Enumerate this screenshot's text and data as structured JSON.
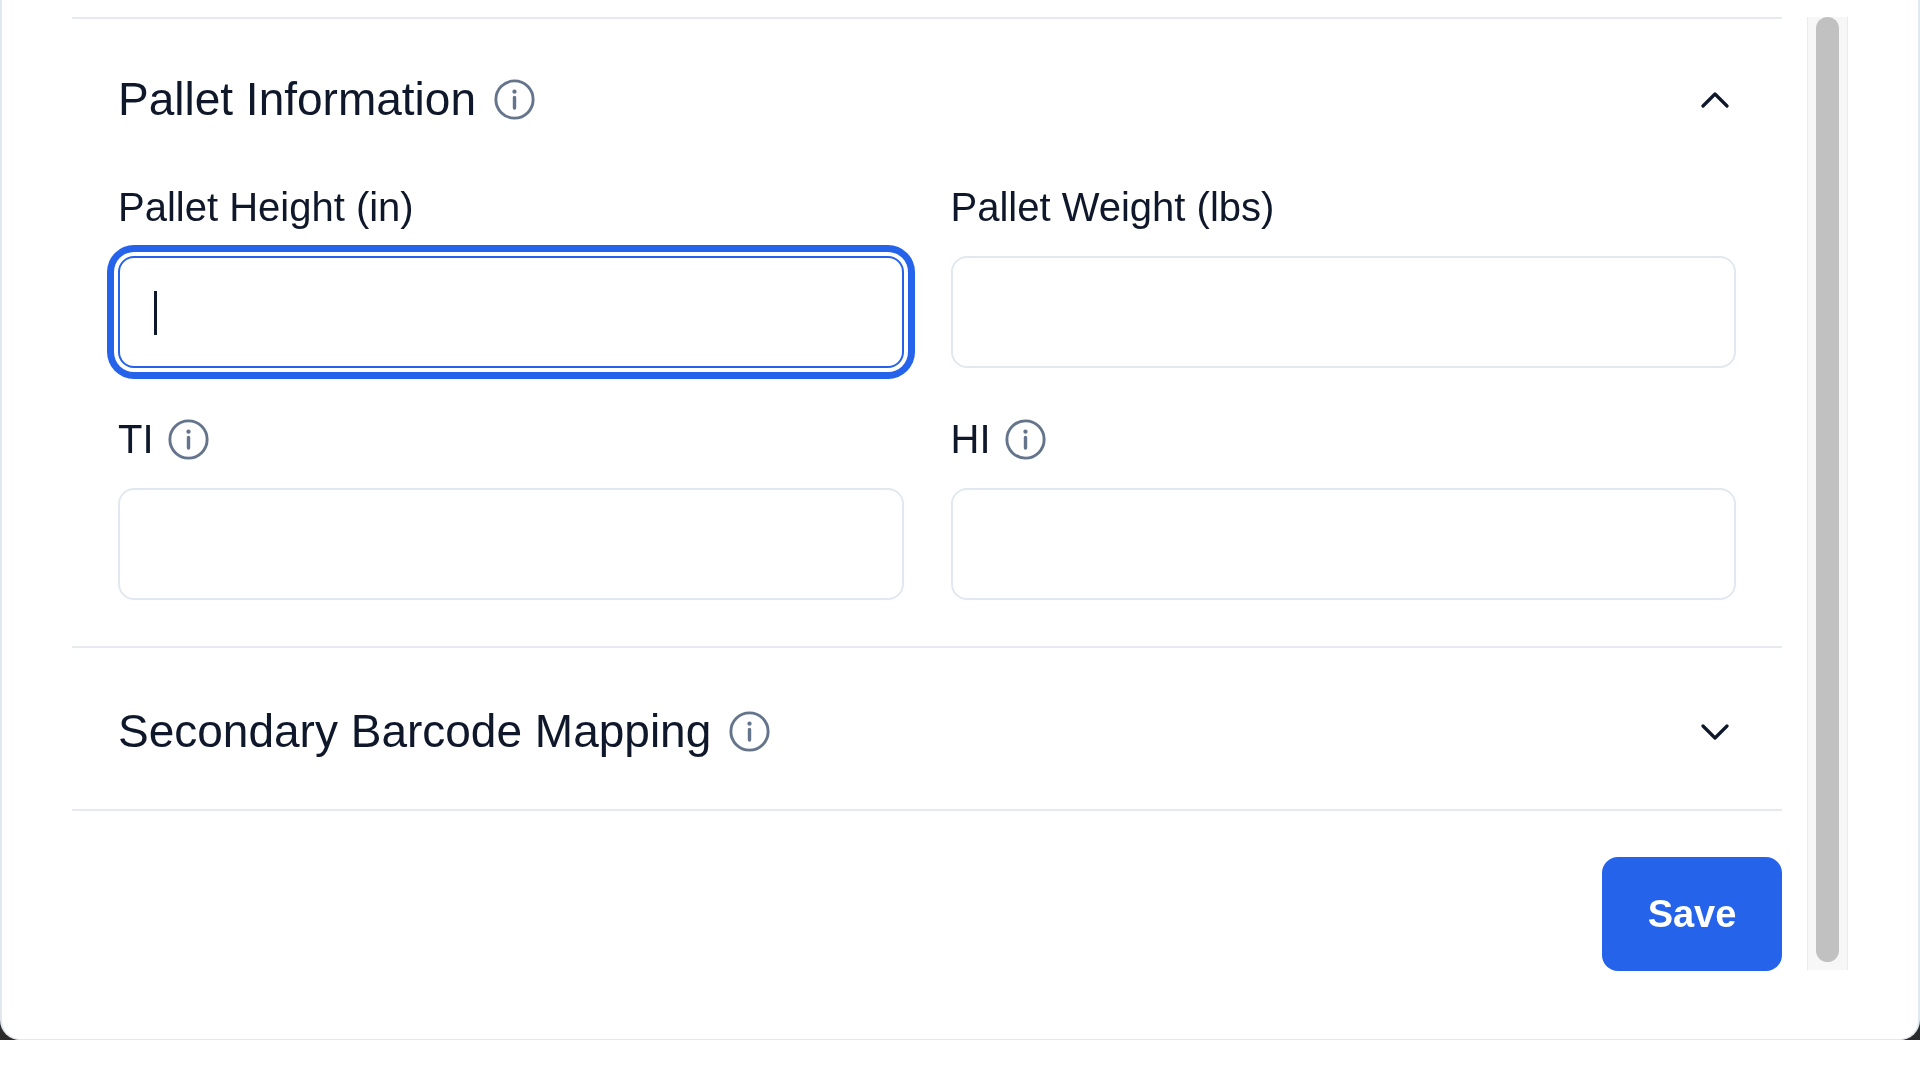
{
  "sections": [
    {
      "title": "Pallet Information",
      "info_icon": true,
      "expanded": true,
      "fields": [
        {
          "label": "Pallet Height (in)",
          "info_icon": false,
          "focused": true
        },
        {
          "label": "Pallet Weight (lbs)",
          "info_icon": false,
          "focused": false
        },
        {
          "label": "TI",
          "info_icon": true,
          "focused": false
        },
        {
          "label": "HI",
          "info_icon": true,
          "focused": false
        }
      ]
    },
    {
      "title": "Secondary Barcode Mapping",
      "info_icon": true,
      "expanded": false
    }
  ],
  "save_button": {
    "label": "Save"
  }
}
